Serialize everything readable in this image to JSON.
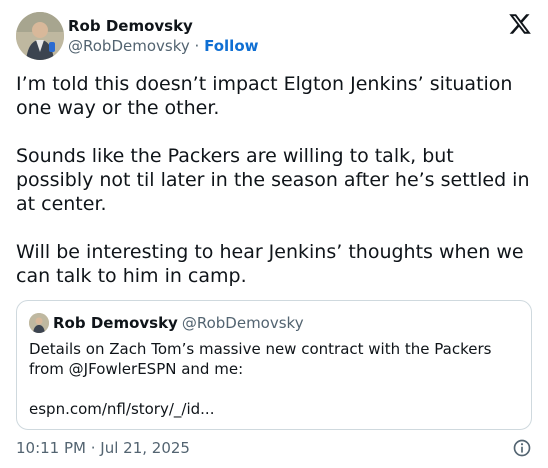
{
  "author": {
    "name": "Rob Demovsky",
    "handle": "@RobDemovsky",
    "separator": "·",
    "follow_label": "Follow",
    "avatar_icon": "profile-photo"
  },
  "platform_icon": "x-logo-icon",
  "tweet": {
    "text": "I’m told this doesn’t impact Elgton Jenkins’ situation one way or the other.\n\nSounds like the Packers are willing to talk, but possibly not til later in the season after he’s settled in at center.\n\nWill be interesting to hear Jenkins’ thoughts when we can talk to him in camp."
  },
  "quoted": {
    "name": "Rob Demovsky",
    "handle": "@RobDemovsky",
    "text": "Details on Zach Tom’s massive new contract with the Packers from @JFowlerESPN and me:\n\nespn.com/nfl/story/_/id..."
  },
  "footer": {
    "timestamp": "10:11 PM · Jul 21, 2025",
    "info_icon": "info-icon"
  },
  "colors": {
    "text": "#0f1419",
    "secondary": "#536471",
    "follow": "#0f6fd3",
    "border": "#cfd9de"
  }
}
